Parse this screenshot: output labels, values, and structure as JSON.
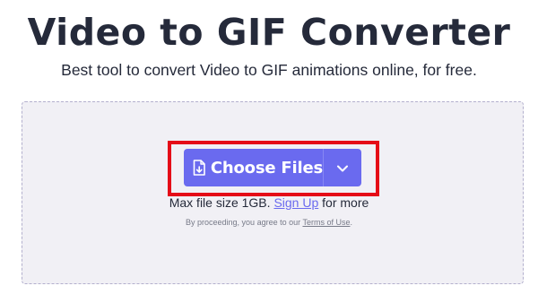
{
  "header": {
    "title": "Video to GIF Converter",
    "subtitle": "Best tool to convert Video to GIF animations online, for free."
  },
  "upload": {
    "choose_files_label": "Choose Files",
    "file_icon": "file-add-icon",
    "dropdown_icon": "chevron-down-icon",
    "max_size_prefix": "Max file size 1GB.",
    "sign_up_label": "Sign Up",
    "max_size_suffix": "for more",
    "terms_prefix": "By proceeding, you agree to our",
    "terms_link": "Terms of Use",
    "terms_suffix": "."
  },
  "colors": {
    "button": "#6a6aef",
    "highlight": "#e50b17",
    "dropzone_bg": "#f1f0f5",
    "title": "#252a3a"
  }
}
